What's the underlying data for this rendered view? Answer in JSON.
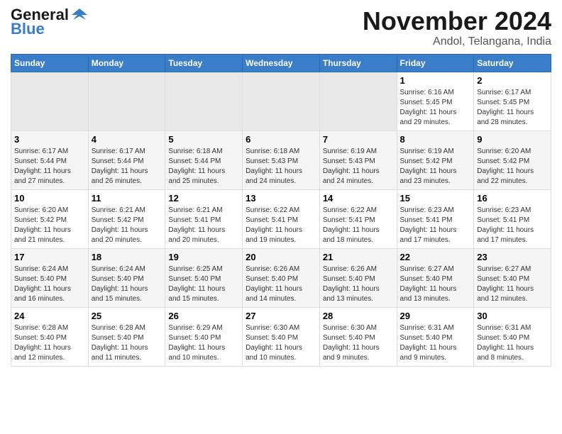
{
  "header": {
    "logo_line1": "General",
    "logo_line2": "Blue",
    "title": "November 2024",
    "location": "Andol, Telangana, India"
  },
  "days_of_week": [
    "Sunday",
    "Monday",
    "Tuesday",
    "Wednesday",
    "Thursday",
    "Friday",
    "Saturday"
  ],
  "weeks": [
    [
      {
        "day": "",
        "info": ""
      },
      {
        "day": "",
        "info": ""
      },
      {
        "day": "",
        "info": ""
      },
      {
        "day": "",
        "info": ""
      },
      {
        "day": "",
        "info": ""
      },
      {
        "day": "1",
        "info": "Sunrise: 6:16 AM\nSunset: 5:45 PM\nDaylight: 11 hours\nand 29 minutes."
      },
      {
        "day": "2",
        "info": "Sunrise: 6:17 AM\nSunset: 5:45 PM\nDaylight: 11 hours\nand 28 minutes."
      }
    ],
    [
      {
        "day": "3",
        "info": "Sunrise: 6:17 AM\nSunset: 5:44 PM\nDaylight: 11 hours\nand 27 minutes."
      },
      {
        "day": "4",
        "info": "Sunrise: 6:17 AM\nSunset: 5:44 PM\nDaylight: 11 hours\nand 26 minutes."
      },
      {
        "day": "5",
        "info": "Sunrise: 6:18 AM\nSunset: 5:44 PM\nDaylight: 11 hours\nand 25 minutes."
      },
      {
        "day": "6",
        "info": "Sunrise: 6:18 AM\nSunset: 5:43 PM\nDaylight: 11 hours\nand 24 minutes."
      },
      {
        "day": "7",
        "info": "Sunrise: 6:19 AM\nSunset: 5:43 PM\nDaylight: 11 hours\nand 24 minutes."
      },
      {
        "day": "8",
        "info": "Sunrise: 6:19 AM\nSunset: 5:42 PM\nDaylight: 11 hours\nand 23 minutes."
      },
      {
        "day": "9",
        "info": "Sunrise: 6:20 AM\nSunset: 5:42 PM\nDaylight: 11 hours\nand 22 minutes."
      }
    ],
    [
      {
        "day": "10",
        "info": "Sunrise: 6:20 AM\nSunset: 5:42 PM\nDaylight: 11 hours\nand 21 minutes."
      },
      {
        "day": "11",
        "info": "Sunrise: 6:21 AM\nSunset: 5:42 PM\nDaylight: 11 hours\nand 20 minutes."
      },
      {
        "day": "12",
        "info": "Sunrise: 6:21 AM\nSunset: 5:41 PM\nDaylight: 11 hours\nand 20 minutes."
      },
      {
        "day": "13",
        "info": "Sunrise: 6:22 AM\nSunset: 5:41 PM\nDaylight: 11 hours\nand 19 minutes."
      },
      {
        "day": "14",
        "info": "Sunrise: 6:22 AM\nSunset: 5:41 PM\nDaylight: 11 hours\nand 18 minutes."
      },
      {
        "day": "15",
        "info": "Sunrise: 6:23 AM\nSunset: 5:41 PM\nDaylight: 11 hours\nand 17 minutes."
      },
      {
        "day": "16",
        "info": "Sunrise: 6:23 AM\nSunset: 5:41 PM\nDaylight: 11 hours\nand 17 minutes."
      }
    ],
    [
      {
        "day": "17",
        "info": "Sunrise: 6:24 AM\nSunset: 5:40 PM\nDaylight: 11 hours\nand 16 minutes."
      },
      {
        "day": "18",
        "info": "Sunrise: 6:24 AM\nSunset: 5:40 PM\nDaylight: 11 hours\nand 15 minutes."
      },
      {
        "day": "19",
        "info": "Sunrise: 6:25 AM\nSunset: 5:40 PM\nDaylight: 11 hours\nand 15 minutes."
      },
      {
        "day": "20",
        "info": "Sunrise: 6:26 AM\nSunset: 5:40 PM\nDaylight: 11 hours\nand 14 minutes."
      },
      {
        "day": "21",
        "info": "Sunrise: 6:26 AM\nSunset: 5:40 PM\nDaylight: 11 hours\nand 13 minutes."
      },
      {
        "day": "22",
        "info": "Sunrise: 6:27 AM\nSunset: 5:40 PM\nDaylight: 11 hours\nand 13 minutes."
      },
      {
        "day": "23",
        "info": "Sunrise: 6:27 AM\nSunset: 5:40 PM\nDaylight: 11 hours\nand 12 minutes."
      }
    ],
    [
      {
        "day": "24",
        "info": "Sunrise: 6:28 AM\nSunset: 5:40 PM\nDaylight: 11 hours\nand 12 minutes."
      },
      {
        "day": "25",
        "info": "Sunrise: 6:28 AM\nSunset: 5:40 PM\nDaylight: 11 hours\nand 11 minutes."
      },
      {
        "day": "26",
        "info": "Sunrise: 6:29 AM\nSunset: 5:40 PM\nDaylight: 11 hours\nand 10 minutes."
      },
      {
        "day": "27",
        "info": "Sunrise: 6:30 AM\nSunset: 5:40 PM\nDaylight: 11 hours\nand 10 minutes."
      },
      {
        "day": "28",
        "info": "Sunrise: 6:30 AM\nSunset: 5:40 PM\nDaylight: 11 hours\nand 9 minutes."
      },
      {
        "day": "29",
        "info": "Sunrise: 6:31 AM\nSunset: 5:40 PM\nDaylight: 11 hours\nand 9 minutes."
      },
      {
        "day": "30",
        "info": "Sunrise: 6:31 AM\nSunset: 5:40 PM\nDaylight: 11 hours\nand 8 minutes."
      }
    ]
  ]
}
